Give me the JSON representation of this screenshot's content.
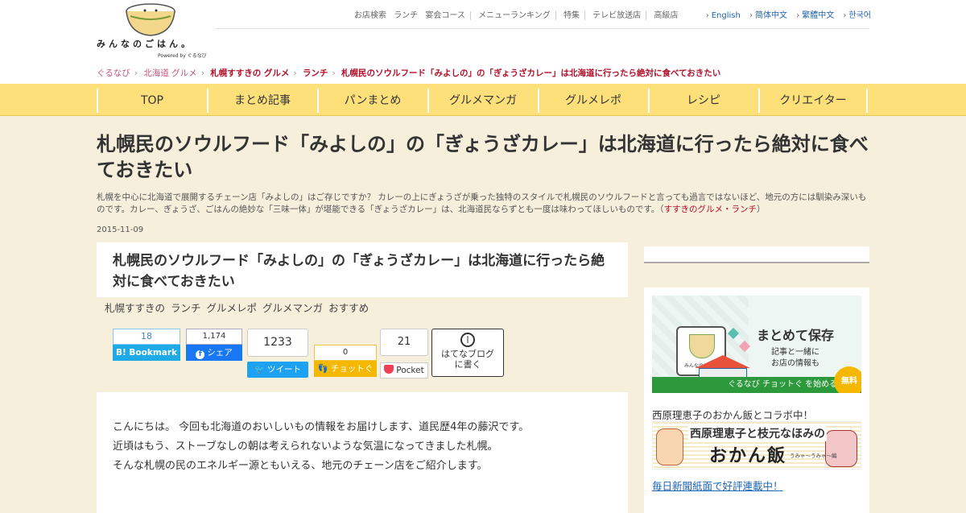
{
  "logo": {
    "text": "みんなのごはん。",
    "powered": "Powered by ぐるなび"
  },
  "topnav": {
    "links": [
      "お店検索",
      "ランチ",
      "宴会コース",
      "メニューランキング",
      "特集",
      "テレビ放送店",
      "高級店"
    ],
    "languages": [
      "English",
      "简体中文",
      "繁體中文",
      "한국어"
    ]
  },
  "breadcrumb": [
    "ぐるなび",
    "北海道 グルメ",
    "札幌すすきの グルメ",
    "ランチ",
    "札幌民のソウルフード「みよしの」の「ぎょうざカレー」は北海道に行ったら絶対に食べておきたい"
  ],
  "mainnav": [
    "TOP",
    "まとめ記事",
    "パンまとめ",
    "グルメマンガ",
    "グルメレポ",
    "レシピ",
    "クリエイター"
  ],
  "article": {
    "title": "札幌民のソウルフード「みよしの」の「ぎょうざカレー」は北海道に行ったら絶対に食べておきたい",
    "lead": "札幌を中心に北海道で展開するチェーン店「みよしの」はご存じですか？ カレーの上にぎょうざが乗った独特のスタイルで札幌民のソウルフードと言っても過言ではないほど、地元の方には馴染み深いものです。カレー、ぎょうざ、ごはんの絶妙な「三味一体」が堪能できる「ぎょうざカレー」は、北海道民ならずとも一度は味わってほしいものです。（",
    "lead_tag": "すすきのグルメ・ランチ",
    "lead_end": "）",
    "date": "2015-11-09",
    "box_title": "札幌民のソウルフード「みよしの」の「ぎょうざカレー」は北海道に行ったら絶対に食べておきたい",
    "tags": [
      "札幌すすきの",
      "ランチ",
      "グルメレポ",
      "グルメマンガ",
      "おすすめ"
    ],
    "body": [
      "こんにちは。 今回も北海道のおいしいもの情報をお届けします、道民歴4年の藤沢です。",
      "近頃はもう、ストーブなしの朝は考えられないような気温になってきました札幌。",
      "そんな札幌の民のエネルギー源ともいえる、地元のチェーン店をご紹介します。"
    ]
  },
  "share": {
    "hatena": {
      "count": "18",
      "label": "B! Bookmark"
    },
    "facebook": {
      "count": "1,174",
      "label": "シェア"
    },
    "twitter": {
      "count": "1233",
      "label": "ツイート"
    },
    "chotto": {
      "count": "0",
      "label": "チョットぐ"
    },
    "pocket": {
      "count": "21",
      "label": "Pocket"
    },
    "hatenablog": {
      "line1": "はてなブログ",
      "line2": "に書く"
    }
  },
  "sidebar": {
    "chotto_banner": {
      "heading": "まとめて保存",
      "sub1": "記事と一緒に",
      "sub2": "お店の情報も",
      "free": "無料",
      "bar": "ぐるなび チョットぐ を始める",
      "mini": "みんなのごはん"
    },
    "okan_caption": "西原理恵子のおかん飯とコラボ中！",
    "okan_banner": {
      "title": "西原理恵子と枝元なほみの",
      "big": "おかん飯",
      "small": "うみゃ〜うみゃ〜編"
    },
    "okan_link": "毎日新聞紙面で好評連載中！"
  }
}
